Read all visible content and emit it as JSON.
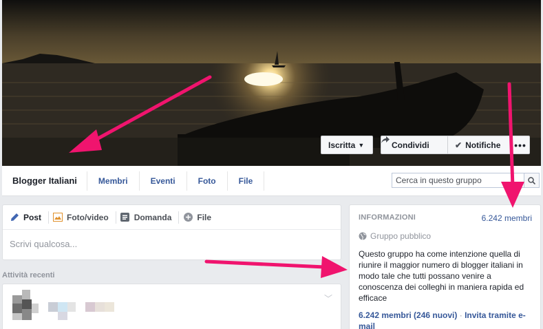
{
  "cover": {
    "buttons": {
      "joined_label": "Iscritta",
      "share_label": "Condividi",
      "notifications_label": "Notifiche",
      "more_label": "•••"
    }
  },
  "nav": {
    "group_name": "Blogger Italiani",
    "tabs": [
      "Membri",
      "Eventi",
      "Foto",
      "File"
    ],
    "search_placeholder": "Cerca in questo gruppo"
  },
  "composer": {
    "tabs": [
      "Post",
      "Foto/video",
      "Domanda",
      "File"
    ],
    "placeholder": "Scrivi qualcosa..."
  },
  "recent": {
    "label": "Attività recenti"
  },
  "info": {
    "title": "INFORMAZIONI",
    "member_count": "6.242 membri",
    "group_type": "Gruppo pubblico",
    "description": "Questo gruppo ha come intenzione quella di riunire il maggior numero di blogger italiani in modo tale che tutti possano venire a conoscenza dei colleghi in maniera rapida ed efficace",
    "members_summary": "6.242 membri (246 nuovi)",
    "separator": "·",
    "invite_label": "Invita tramite e-mail"
  },
  "colors": {
    "link": "#365899",
    "annotation_arrow": "#f0146e",
    "background": "#e9ebee"
  }
}
